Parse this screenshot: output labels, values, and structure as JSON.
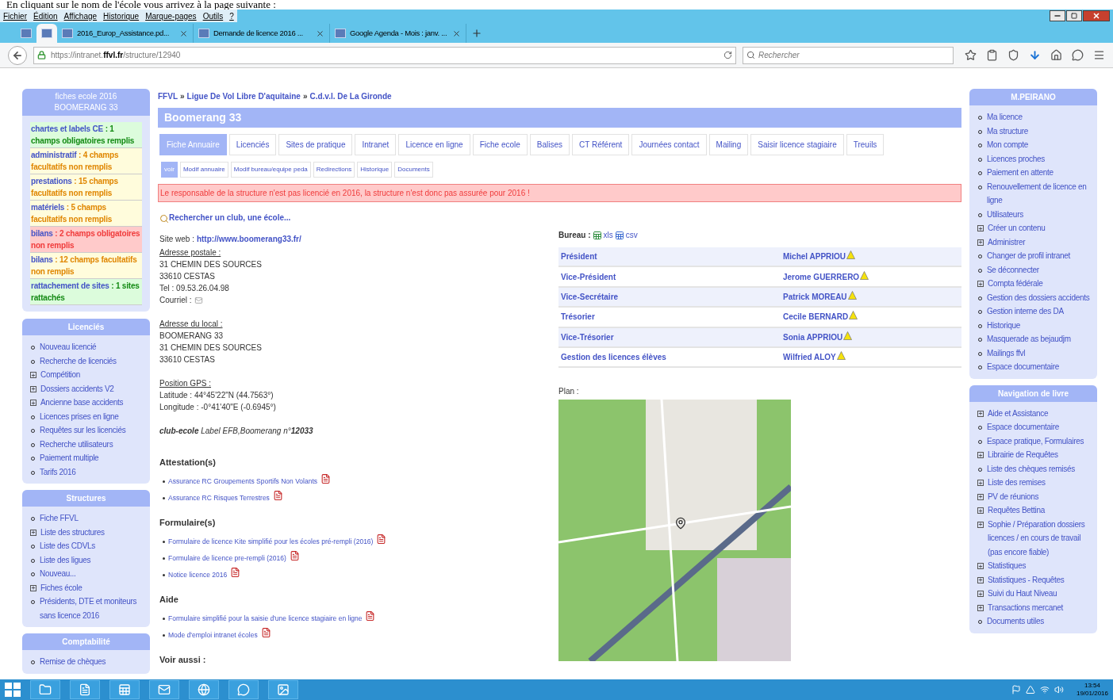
{
  "caption": "En cliquant sur le nom de l'école vous arrivez à la page suivante :",
  "menu_bar": [
    "Fichier",
    "Édition",
    "Affichage",
    "Historique",
    "Marque-pages",
    "Outils",
    "?"
  ],
  "browser_tabs": [
    {
      "kind": "pinned",
      "selected": false
    },
    {
      "kind": "pinned",
      "selected": true
    },
    {
      "kind": "page",
      "title": "2016_Europ_Assistance.pd...",
      "selected": false
    },
    {
      "kind": "page",
      "title": "Demande de licence 2016 ...",
      "selected": false
    },
    {
      "kind": "page",
      "title": "Google Agenda - Mois : janv. ...",
      "selected": false
    }
  ],
  "url": "https://intranet.**ffvl.fr**/structure/12940",
  "search": {
    "placeholder": "Rechercher"
  },
  "fiche_ecole": {
    "title_lines": [
      "fiches ecole 2016",
      "BOOMERANG 33"
    ],
    "items": [
      {
        "label": "chartes et labels CE",
        "detail": " : 1 champs obligatoires remplis",
        "kind": "ok"
      },
      {
        "label": "administratif",
        "detail": " : 4 champs facultatifs non remplis",
        "kind": "warn"
      },
      {
        "label": "prestations",
        "detail": " : 15 champs facultatifs non remplis",
        "kind": "warn"
      },
      {
        "label": "matériels",
        "detail": " : 5 champs facultatifs non remplis",
        "kind": "warn"
      },
      {
        "label": "bilans",
        "detail": " : 2 champs obligatoires non remplis",
        "kind": "error"
      },
      {
        "label": "bilans",
        "detail": " : 12 champs facultatifs non remplis",
        "kind": "warn"
      },
      {
        "label": "rattachement de sites",
        "detail": " : 1 sites rattachés",
        "kind": "ok"
      }
    ]
  },
  "left_blocks": [
    {
      "title": "Licenciés",
      "items": [
        {
          "label": "Nouveau licencié",
          "kind": "bullet"
        },
        {
          "label": "Recherche de licenciés",
          "kind": "bullet"
        },
        {
          "label": "Compétition",
          "kind": "expandable"
        },
        {
          "label": "Dossiers accidents V2",
          "kind": "expandable"
        },
        {
          "label": "Ancienne base accidents",
          "kind": "expandable"
        },
        {
          "label": "Licences prises en ligne",
          "kind": "bullet"
        },
        {
          "label": "Requêtes sur les licenciés",
          "kind": "bullet"
        },
        {
          "label": "Recherche utilisateurs",
          "kind": "bullet"
        },
        {
          "label": "Paiement multiple",
          "kind": "bullet"
        },
        {
          "label": "Tarifs 2016",
          "kind": "bullet"
        }
      ]
    },
    {
      "title": "Structures",
      "items": [
        {
          "label": "Fiche FFVL",
          "kind": "bullet"
        },
        {
          "label": "Liste des structures",
          "kind": "expandable"
        },
        {
          "label": "Liste des CDVLs",
          "kind": "bullet"
        },
        {
          "label": "Liste des ligues",
          "kind": "bullet"
        },
        {
          "label": "Nouveau...",
          "kind": "bullet"
        },
        {
          "label": "Fiches école",
          "kind": "expandable"
        },
        {
          "label": "Présidents, DTE et moniteurs sans licence 2016",
          "kind": "bullet"
        }
      ]
    },
    {
      "title": "Comptabilité",
      "items": [
        {
          "label": "Remise de chèques",
          "kind": "bullet"
        }
      ]
    }
  ],
  "breadcrumb_separator": "»",
  "breadcrumb": [
    "FFVL",
    "Ligue De Vol Libre D'aquitaine",
    "C.d.v.l. De La Gironde"
  ],
  "structure_title": "Boomerang 33",
  "tabs": [
    {
      "label": "Fiche Annuaire",
      "selected": true
    },
    {
      "label": "Licenciés",
      "selected": false
    },
    {
      "label": "Sites de pratique",
      "selected": false
    },
    {
      "label": "Intranet",
      "selected": false
    },
    {
      "label": "Licence en ligne",
      "selected": false
    },
    {
      "label": "Fiche ecole",
      "selected": false
    },
    {
      "label": "Balises",
      "selected": false
    },
    {
      "label": "CT Référent",
      "selected": false
    },
    {
      "label": "Journées contact",
      "selected": false
    },
    {
      "label": "Mailing",
      "selected": false
    },
    {
      "label": "Saisir licence stagiaire",
      "selected": false
    },
    {
      "label": "Treuils",
      "selected": false
    }
  ],
  "subtabs": [
    {
      "label": "voir",
      "selected": true
    },
    {
      "label": "Modif annuaire",
      "selected": false
    },
    {
      "label": "Modif bureau/equipe peda",
      "selected": false
    },
    {
      "label": "Redirections",
      "selected": false
    },
    {
      "label": "Historique",
      "selected": false
    },
    {
      "label": "Documents",
      "selected": false
    }
  ],
  "alert": "Le responsable de la structure n'est pas licencié en 2016, la structure n'est donc pas assurée pour 2016 !",
  "search_link": "Rechercher un club, une école...",
  "site_web": {
    "label": "Site web :",
    "url": "http://www.boomerang33.fr/"
  },
  "postal_address": {
    "heading": "Adresse postale :",
    "lines": [
      "31 CHEMIN DES SOURCES",
      "33610 CESTAS",
      "Tel : 09.53.26.04.98"
    ],
    "email_label": "Courriel :"
  },
  "local_address": {
    "heading": "Adresse du local :",
    "lines": [
      "BOOMERANG 33",
      "31 CHEMIN DES SOURCES",
      "33610 CESTAS"
    ]
  },
  "gps": {
    "heading": "Position GPS :",
    "lines": [
      "Latitude : 44°45'22\"N (44.7563°)",
      "Longitude : -0°41'40\"E (-0.6945°)"
    ]
  },
  "label_line": "**club-ecole** Label EFB,Boomerang n°**12033**",
  "sections": [
    {
      "heading": "Attestation(s)",
      "links": [
        "Assurance RC Groupements Sportifs Non Volants",
        "Assurance RC Risques Terrestres"
      ]
    },
    {
      "heading": "Formulaire(s)",
      "links": [
        "Formulaire de licence Kite simplifié pour les écoles pré-rempli (2016)",
        "Formulaire de licence pre-rempli (2016)",
        "Notice licence 2016"
      ]
    },
    {
      "heading": "Aide",
      "links": [
        "Formulaire simplifié pour la saisie d'une licence stagiaire en ligne",
        "Mode d'emploi intranet écoles"
      ]
    },
    {
      "heading": "Voir aussi :"
    }
  ],
  "bureau": {
    "label": "Bureau :",
    "xls": "xls",
    "csv": "csv",
    "rows": [
      {
        "role": "Président",
        "name": "Michel APPRIOU"
      },
      {
        "role": "Vice-Président",
        "name": "Jerome GUERRERO"
      },
      {
        "role": "Vice-Secrétaire",
        "name": "Patrick MOREAU"
      },
      {
        "role": "Trésorier",
        "name": "Cecile BERNARD"
      },
      {
        "role": "Vice-Trésorier",
        "name": "Sonia APPRIOU"
      },
      {
        "role": "Gestion des licences élèves",
        "name": "Wilfried ALOY"
      }
    ]
  },
  "plan_label": "Plan :",
  "right_blocks": [
    {
      "title": "M.PEIRANO",
      "items": [
        {
          "label": "Ma licence",
          "kind": "bullet"
        },
        {
          "label": "Ma structure",
          "kind": "bullet"
        },
        {
          "label": "Mon compte",
          "kind": "bullet"
        },
        {
          "label": "Licences proches",
          "kind": "bullet"
        },
        {
          "label": "Paiement en attente",
          "kind": "bullet"
        },
        {
          "label": "Renouvellement de licence en ligne",
          "kind": "bullet"
        },
        {
          "label": "Utilisateurs",
          "kind": "bullet"
        },
        {
          "label": "Créer un contenu",
          "kind": "expandable"
        },
        {
          "label": "Administrer",
          "kind": "expandable"
        },
        {
          "label": "Changer de profil intranet",
          "kind": "bullet"
        },
        {
          "label": "Se déconnecter",
          "kind": "bullet"
        },
        {
          "label": "Compta fédérale",
          "kind": "expandable"
        },
        {
          "label": "Gestion des dossiers accidents",
          "kind": "bullet"
        },
        {
          "label": "Gestion interne des DA",
          "kind": "bullet"
        },
        {
          "label": "Historique",
          "kind": "bullet"
        },
        {
          "label": "Masquerade as bejaudjm",
          "kind": "bullet"
        },
        {
          "label": "Mailings ffvl",
          "kind": "bullet"
        },
        {
          "label": "Espace documentaire",
          "kind": "bullet"
        }
      ]
    },
    {
      "title": "Navigation de livre",
      "items": [
        {
          "label": "Aide et Assistance",
          "kind": "expandable"
        },
        {
          "label": "Espace documentaire",
          "kind": "bullet"
        },
        {
          "label": "Espace pratique, Formulaires",
          "kind": "bullet"
        },
        {
          "label": "Librairie de Requêtes",
          "kind": "expandable"
        },
        {
          "label": "Liste des chèques remisés",
          "kind": "bullet"
        },
        {
          "label": "Liste des remises",
          "kind": "expandable"
        },
        {
          "label": "PV de réunions",
          "kind": "expandable"
        },
        {
          "label": "Requêtes Bettina",
          "kind": "expandable"
        },
        {
          "label": "Sophie / Préparation dossiers licences / en cours de travail (pas encore fiable)",
          "kind": "expandable"
        },
        {
          "label": "Statistiques",
          "kind": "expandable"
        },
        {
          "label": "Statistiques - Requêtes",
          "kind": "expandable"
        },
        {
          "label": "Suivi du Haut Niveau",
          "kind": "expandable"
        },
        {
          "label": "Transactions mercanet",
          "kind": "expandable"
        },
        {
          "label": "Documents utiles",
          "kind": "bullet"
        }
      ]
    }
  ],
  "clock": {
    "time": "13:54",
    "date": "19/01/2016"
  }
}
